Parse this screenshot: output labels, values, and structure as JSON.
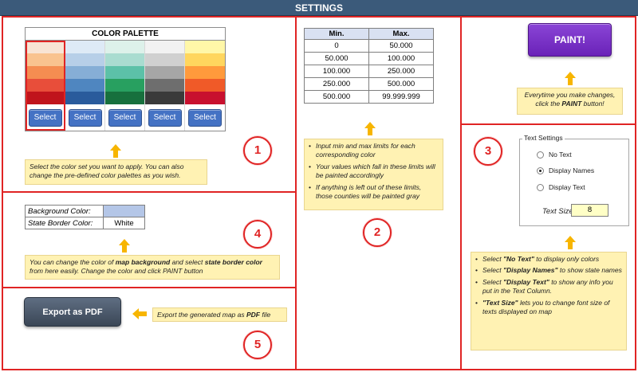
{
  "header": {
    "title": "SETTINGS"
  },
  "palette": {
    "title": "COLOR PALETTE",
    "select_label": "Select",
    "columns": [
      {
        "swatches": [
          "#f8e4d4",
          "#f9c38f",
          "#f58d51",
          "#e84e3a",
          "#c0141c"
        ]
      },
      {
        "swatches": [
          "#deeaf6",
          "#b7cfe8",
          "#86aed6",
          "#4f86c0",
          "#2a5b9c"
        ]
      },
      {
        "swatches": [
          "#ddf1ea",
          "#a9dcd0",
          "#5cc1a8",
          "#28a060",
          "#17703d"
        ]
      },
      {
        "swatches": [
          "#f2f2f2",
          "#d0d0d0",
          "#a6a6a6",
          "#6e6e6e",
          "#3a3a3a"
        ]
      },
      {
        "swatches": [
          "#fff7a8",
          "#ffd65e",
          "#ff9a3c",
          "#f05a28",
          "#c8102e"
        ]
      }
    ],
    "note": "Select the color set you want to apply. You can also change the pre-defined color palettes as you wish."
  },
  "minmax": {
    "headers": [
      "Min.",
      "Max."
    ],
    "rows": [
      [
        "0",
        "50.000"
      ],
      [
        "50.000",
        "100.000"
      ],
      [
        "100.000",
        "250.000"
      ],
      [
        "250.000",
        "500.000"
      ],
      [
        "500.000",
        "99.999.999"
      ]
    ],
    "notes": [
      "Input min and max limits for each corresponding color",
      "Your values which fall in these limits will be painted accordingly",
      "If anything is left out of these limits, those counties will be painted gray"
    ]
  },
  "paint": {
    "button_label": "PAINT!",
    "note_prefix": "Everytime you make changes, click the ",
    "note_bold": "PAINT",
    "note_suffix": " button!"
  },
  "text_settings": {
    "legend": "Text Settings",
    "options": [
      "No Text",
      "Display Names",
      "Display Text"
    ],
    "selected": "Display Names",
    "size_label": "Text Size:",
    "size_value": "8",
    "notes": [
      {
        "pre": "Select ",
        "bold": "\"No Text\"",
        "post": " to display only colors"
      },
      {
        "pre": "Select ",
        "bold": "\"Display Names\"",
        "post": " to show state names"
      },
      {
        "pre": "Select ",
        "bold": "\"Display Text\"",
        "post": " to show any info you put in the Text Column."
      },
      {
        "pre": "",
        "bold": "\"Text Size\"",
        "post": " lets you to change font size of texts displayed on map"
      }
    ]
  },
  "colors_settings": {
    "background_label": "Background Color:",
    "background_value": "",
    "background_color": "#b4c6e7",
    "border_label": "State Border Color:",
    "border_value": "White",
    "note_part1": "You can change the color of ",
    "note_bold1": "map background",
    "note_part2": " and select ",
    "note_bold2": "state border color",
    "note_part3": " from here easily. Change the color and click PAINT button"
  },
  "export": {
    "button_label": "Export as PDF",
    "note_prefix": "Export the generated map as ",
    "note_bold": "PDF",
    "note_suffix": " file"
  },
  "steps": [
    "1",
    "2",
    "3",
    "4",
    "5"
  ]
}
